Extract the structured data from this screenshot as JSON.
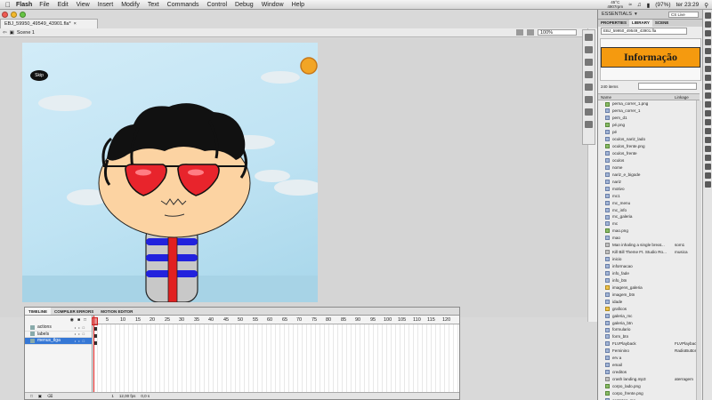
{
  "menubar": {
    "app_name": "Flash",
    "items": [
      "File",
      "Edit",
      "View",
      "Insert",
      "Modify",
      "Text",
      "Commands",
      "Control",
      "Debug",
      "Window",
      "Help"
    ],
    "temp_top": "45°C",
    "temp_bottom": "4907rpm",
    "battery": "(97%)",
    "clock": "ter 23:29"
  },
  "document": {
    "tab_title": "EBJ_59950_49549_43901.fla*",
    "scene": "Scene 1",
    "zoom": "100%"
  },
  "stage": {
    "skip_label": "Skip",
    "colors": {
      "sky": "#c6e6f5",
      "sun": "#f2a526",
      "skin": "#fcd3a2",
      "glasses": "#e8242c",
      "hair": "#111111",
      "shirt_stripe": "#2222dd",
      "shirt_base": "#c8c8c8",
      "tie": "#e12020"
    }
  },
  "timeline": {
    "tabs": [
      "TIMELINE",
      "COMPILER ERRORS",
      "MOTION EDITOR"
    ],
    "layers": [
      {
        "name": "actions",
        "selected": false
      },
      {
        "name": "labels",
        "selected": false
      },
      {
        "name": "menus_tlga",
        "selected": true
      }
    ],
    "ruler": [
      "5",
      "10",
      "15",
      "20",
      "25",
      "30",
      "35",
      "40",
      "45",
      "50",
      "55",
      "60",
      "65",
      "70",
      "75",
      "80",
      "85",
      "90",
      "95",
      "100",
      "105",
      "110",
      "115",
      "120"
    ],
    "status": {
      "frame": "1",
      "fps": "12,00 fps",
      "time": "0,0 s"
    }
  },
  "panel": {
    "workspace": "ESSENTIALS",
    "cs_live": "CS Live",
    "tabs": [
      "PROPERTIES",
      "LIBRARY",
      "SCENE"
    ],
    "library_file": "EBJ_59950_49549_43901.fla",
    "preview_text": "Informação",
    "item_count": "240 items",
    "col_name": "Name",
    "col_linkage": "Linkage",
    "items": [
      {
        "name": "perna_correr_1.png",
        "type": "bmp",
        "linkage": ""
      },
      {
        "name": "perna_correr_1",
        "type": "sym",
        "linkage": ""
      },
      {
        "name": "pem_d1",
        "type": "sym",
        "linkage": ""
      },
      {
        "name": "pé.png",
        "type": "bmp",
        "linkage": ""
      },
      {
        "name": "pé",
        "type": "sym",
        "linkage": ""
      },
      {
        "name": "oculos_nariz_lado",
        "type": "sym",
        "linkage": ""
      },
      {
        "name": "oculos_frente.png",
        "type": "bmp",
        "linkage": ""
      },
      {
        "name": "oculos_frente",
        "type": "sym",
        "linkage": ""
      },
      {
        "name": "oculos",
        "type": "sym",
        "linkage": ""
      },
      {
        "name": "nome",
        "type": "sym",
        "linkage": ""
      },
      {
        "name": "nariz_e_bigode",
        "type": "sym",
        "linkage": ""
      },
      {
        "name": "nariz",
        "type": "sym",
        "linkage": ""
      },
      {
        "name": "motivo",
        "type": "sym",
        "linkage": ""
      },
      {
        "name": "mc1",
        "type": "sym",
        "linkage": ""
      },
      {
        "name": "mc_menu",
        "type": "sym",
        "linkage": ""
      },
      {
        "name": "mc_info",
        "type": "sym",
        "linkage": ""
      },
      {
        "name": "mc_galeria",
        "type": "sym",
        "linkage": ""
      },
      {
        "name": "mc",
        "type": "sym",
        "linkage": ""
      },
      {
        "name": "mao.png",
        "type": "bmp",
        "linkage": ""
      },
      {
        "name": "mao",
        "type": "sym",
        "linkage": ""
      },
      {
        "name": "Man inhaling a single breat...",
        "type": "snd",
        "linkage": "som1"
      },
      {
        "name": "Kill Bill Theme Ft. Studio Ro...",
        "type": "snd",
        "linkage": "musica"
      },
      {
        "name": "inicio",
        "type": "sym",
        "linkage": ""
      },
      {
        "name": "informacao",
        "type": "sym",
        "linkage": ""
      },
      {
        "name": "info_fade",
        "type": "sym",
        "linkage": ""
      },
      {
        "name": "info_btn",
        "type": "sym",
        "linkage": ""
      },
      {
        "name": "imagens_galeria",
        "type": "folder",
        "linkage": ""
      },
      {
        "name": "imagem_btn",
        "type": "sym",
        "linkage": ""
      },
      {
        "name": "idade",
        "type": "sym",
        "linkage": ""
      },
      {
        "name": "graficos",
        "type": "folder",
        "linkage": ""
      },
      {
        "name": "galeria_mc",
        "type": "sym",
        "linkage": ""
      },
      {
        "name": "galeria_btn",
        "type": "sym",
        "linkage": ""
      },
      {
        "name": "formulario",
        "type": "sym",
        "linkage": ""
      },
      {
        "name": "form_btn",
        "type": "sym",
        "linkage": ""
      },
      {
        "name": "FLVPlayback",
        "type": "sym",
        "linkage": "FLVPlayback"
      },
      {
        "name": "Feminino",
        "type": "sym",
        "linkage": "RadioButton"
      },
      {
        "name": "erv a",
        "type": "sym",
        "linkage": ""
      },
      {
        "name": "email",
        "type": "sym",
        "linkage": ""
      },
      {
        "name": "creditos",
        "type": "sym",
        "linkage": ""
      },
      {
        "name": "crash landing.mp3",
        "type": "snd",
        "linkage": "aterragem"
      },
      {
        "name": "corpo_lado.png",
        "type": "bmp",
        "linkage": ""
      },
      {
        "name": "corpo_frente.png",
        "type": "bmp",
        "linkage": ""
      },
      {
        "name": "contatos_mc",
        "type": "sym",
        "linkage": ""
      }
    ]
  }
}
